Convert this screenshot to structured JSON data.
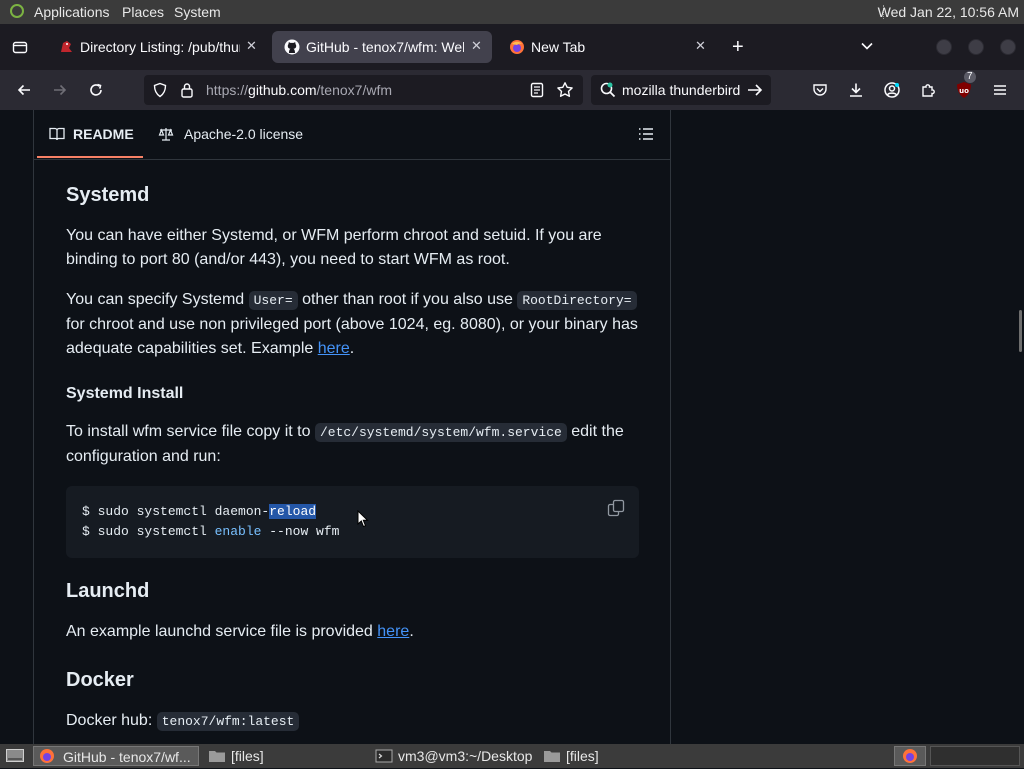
{
  "system_panel": {
    "menus": [
      "Applications",
      "Places",
      "System"
    ],
    "clock": "Wed Jan 22, 10:56 AM"
  },
  "browser": {
    "tabs": [
      {
        "title": "Directory Listing: /pub/thun",
        "icon": "red-dragon-icon"
      },
      {
        "title": "GitHub - tenox7/wfm: Web",
        "icon": "github-icon"
      },
      {
        "title": "New Tab",
        "icon": "firefox-icon"
      }
    ],
    "url_prefix": "https://",
    "url_host": "github.com",
    "url_path": "/tenox7/wfm",
    "search_text": "mozilla thunderbird",
    "extension_badge": "7"
  },
  "readme_header": {
    "readme_tab": "README",
    "license_tab": "Apache-2.0 license"
  },
  "doc": {
    "systemd_heading": "Systemd",
    "p1": "You can have either Systemd, or WFM perform chroot and setuid. If you are binding to port 80 (and/or 443), you need to start WFM as root.",
    "p2_a": "You can specify Systemd ",
    "p2_code1": "User=",
    "p2_b": " other than root if you also use ",
    "p2_code2": "RootDirectory=",
    "p2_c": " for chroot and use non privileged port (above 1024, eg. 8080), or your binary has adequate capabilities set. Example ",
    "p2_link": "here",
    "p2_end": ".",
    "install_heading": "Systemd Install",
    "p3_a": "To install wfm service file copy it to ",
    "p3_code": "/etc/systemd/system/wfm.service",
    "p3_b": " edit the configuration and run:",
    "code_l1_a": "$ sudo systemctl daemon-",
    "code_l1_sel": "reload",
    "code_l2_a": "$ sudo systemctl ",
    "code_l2_kw": "enable",
    "code_l2_b": " --now wfm",
    "launchd_heading": "Launchd",
    "p4_a": "An example launchd service file is provided ",
    "p4_link": "here",
    "p4_end": ".",
    "docker_heading": "Docker",
    "p5_a": "Docker hub: ",
    "p5_code": "tenox7/wfm:latest"
  },
  "taskbar": {
    "items": [
      "GitHub - tenox7/wf...",
      "[files]",
      "vm3@vm3:~/Desktop",
      "[files]"
    ]
  }
}
